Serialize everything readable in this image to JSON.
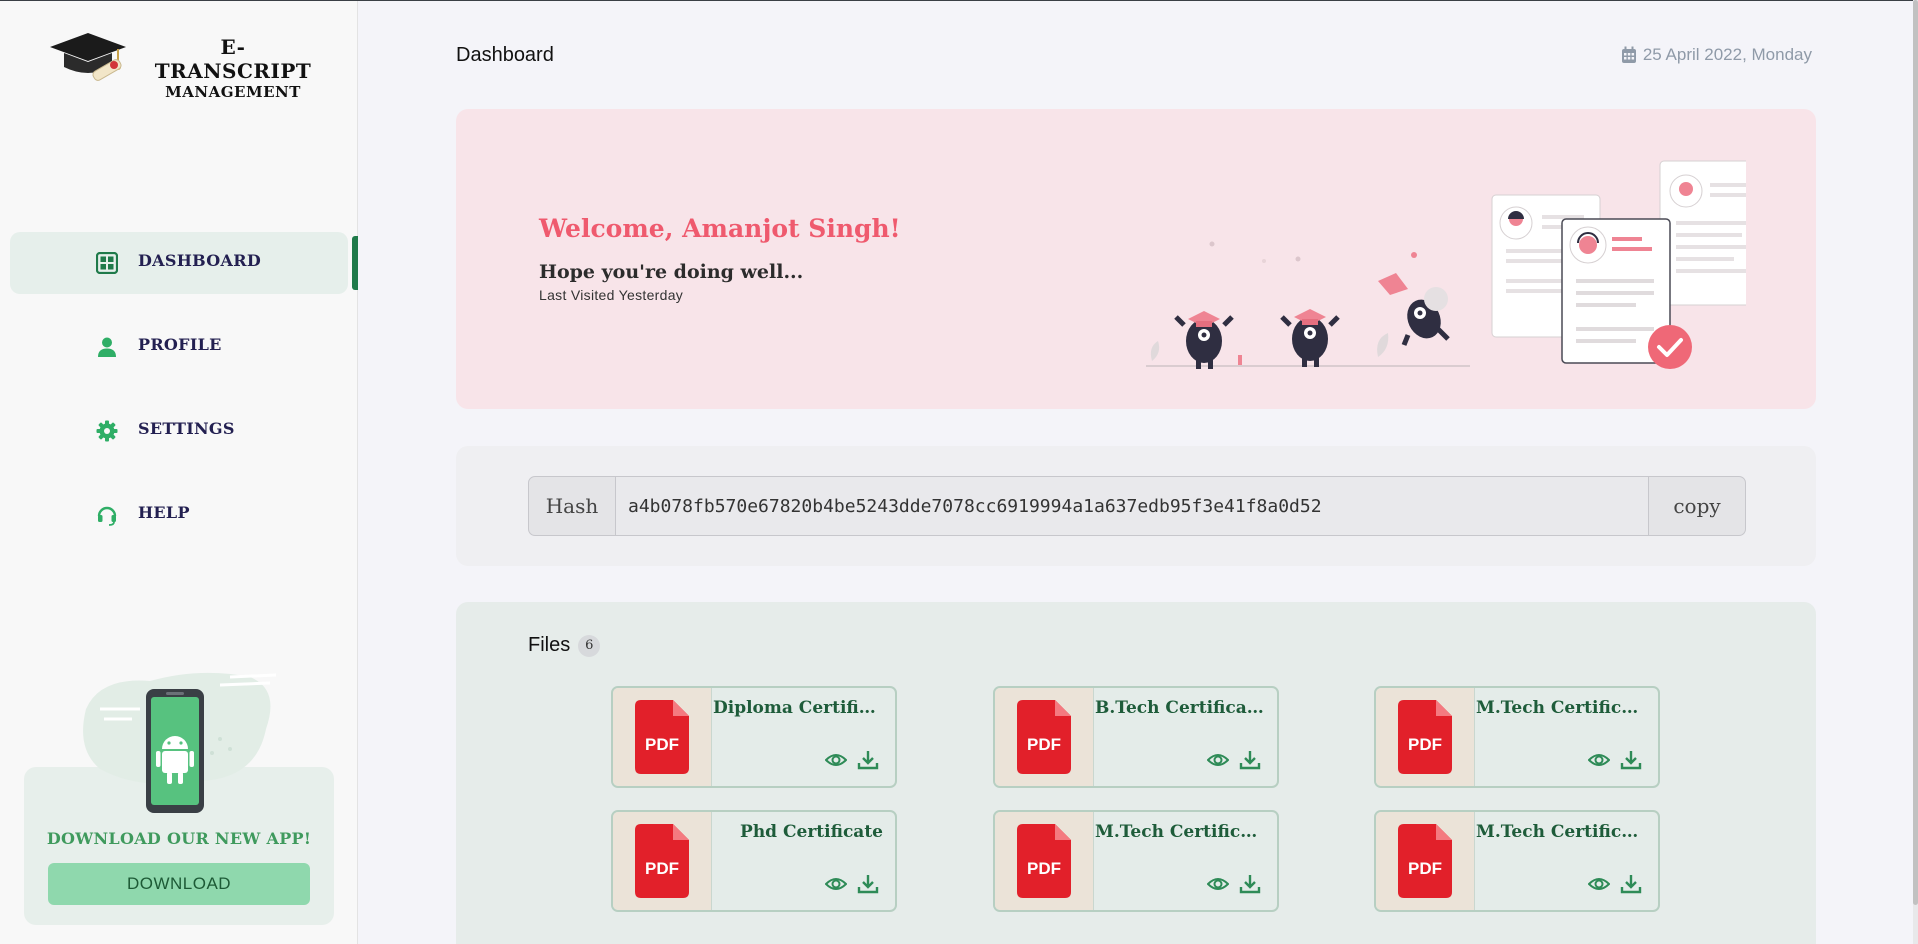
{
  "brand": {
    "line1": "E-TRANSCRIPT",
    "line2": "MANAGEMENT",
    "logo_icon": "graduation-cap-logo"
  },
  "sidebar": {
    "items": [
      {
        "label": "DASHBOARD",
        "icon": "grid-icon",
        "active": true
      },
      {
        "label": "PROFILE",
        "icon": "user-icon",
        "active": false
      },
      {
        "label": "SETTINGS",
        "icon": "gear-icon",
        "active": false
      },
      {
        "label": "HELP",
        "icon": "headset-icon",
        "active": false
      }
    ],
    "app_promo": {
      "title": "DOWNLOAD OUR NEW APP!",
      "button": "DOWNLOAD"
    }
  },
  "header": {
    "title": "Dashboard",
    "date": "25 April 2022, Monday",
    "date_icon": "calendar-icon"
  },
  "welcome": {
    "title": "Welcome, Amanjot Singh!",
    "subtitle": "Hope you're doing well...",
    "last_visited": "Last Visited Yesterday"
  },
  "hash": {
    "label": "Hash",
    "value": "a4b078fb570e67820b4be5243dde7078cc6919994a1a637edb95f3e41f8a0d52",
    "copy_label": "copy"
  },
  "files": {
    "title": "Files",
    "count": "6",
    "items": [
      {
        "name": "Diploma Certificate",
        "type": "PDF"
      },
      {
        "name": "B.Tech Certificate",
        "type": "PDF"
      },
      {
        "name": "M.Tech Certificate",
        "type": "PDF"
      },
      {
        "name": "Phd Certificate",
        "type": "PDF"
      },
      {
        "name": "M.Tech Certificate",
        "type": "PDF"
      },
      {
        "name": "M.Tech Certificate",
        "type": "PDF"
      }
    ]
  },
  "colors": {
    "accent_green": "#1f7a4a",
    "welcome_bg": "#f8e4e9",
    "welcome_title": "#ef5a6e",
    "pdf_red": "#e2202a",
    "download_btn": "#8fd8ad"
  }
}
